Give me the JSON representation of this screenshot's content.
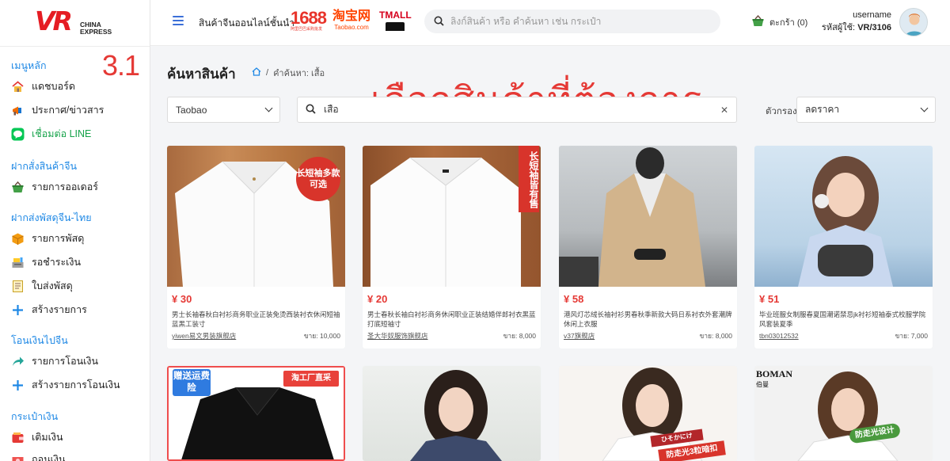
{
  "brand": {
    "logo_letters": "VR",
    "logo_line1": "CHINA",
    "logo_line2": "EXPRESS"
  },
  "step_label": "3.1",
  "sidebar": {
    "sections": [
      {
        "title": "เมนูหลัก",
        "items": [
          "แดชบอร์ด",
          "ประกาศ/ข่าวสาร",
          "เชื่อมต่อ LINE"
        ]
      },
      {
        "title": "ฝากสั่งสินค้าจีน",
        "items": [
          "รายการออเดอร์"
        ]
      },
      {
        "title": "ฝากส่งพัสดุจีน-ไทย",
        "items": [
          "รายการพัสดุ",
          "รอชำระเงิน",
          "ใบส่งพัสดุ",
          "สร้างรายการ"
        ]
      },
      {
        "title": "โอนเงินไปจีน",
        "items": [
          "รายการโอนเงิน",
          "สร้างรายการโอนเงิน"
        ]
      },
      {
        "title": "กระเป๋าเงิน",
        "items": [
          "เติมเงิน",
          "ถอนเงิน"
        ]
      }
    ]
  },
  "header": {
    "menu_icon": "hamburger-icon",
    "title": "สินค้าจีนออนไลน์ชั้นนำ",
    "brand_1688": "1688",
    "brand_1688_sub": "阿里巴巴采购批发",
    "brand_taobao": "淘宝网",
    "brand_taobao_sub": "Taobao.com",
    "brand_tmall": "TMALL",
    "search_placeholder": "ลิงก์สินค้า หรือ คำค้นหา เช่น กระเป๋า",
    "cart_label": "ตะกร้า (0)",
    "username": "username",
    "user_code_label": "รหัสผู้ใช้:",
    "user_code": "VR/3106"
  },
  "main": {
    "page_title": "ค้นหาสินค้า",
    "breadcrumb_current": "คำค้นหา: เสื้อ",
    "headline": "เลือกสินค้าที่ต้องการ",
    "source": "Taobao",
    "keyword": "เสื้อ",
    "filter_label": "ตัวกรอง",
    "sort": "ลดราคา"
  },
  "products": [
    {
      "price": "¥ 30",
      "name": "男士长袖春秋白衬衫商务职业正装免烫西装衬衣休闲短袖蓝黑工装寸",
      "shop": "yiwen易文男装旗舰店",
      "sold": "ขาย: 10,000",
      "tag": "长短袖多款可选"
    },
    {
      "price": "¥ 20",
      "name": "男士春秋长袖白衬衫商务休闲职业正装结婚伴郎衬衣黑蓝打底短袖寸",
      "shop": "圣大华奴服饰旗舰店",
      "sold": "ขาย: 8,000",
      "tag": "长短袖皆有售"
    },
    {
      "price": "¥ 58",
      "name": "港风灯芯绒长袖衬衫男春秋季新款大码日系衬衣外套潮牌休闲上衣服",
      "shop": "v37旗舰店",
      "sold": "ขาย: 8,000",
      "tag": ""
    },
    {
      "price": "¥ 51",
      "name": "毕业班服女制服春夏国潮诺禁忌jk衬衫短袖泰式校服学院风套装夏季",
      "shop": "tbn03012532",
      "sold": "ขาย: 7,000",
      "tag": ""
    },
    {
      "price": "",
      "name": "",
      "shop": "",
      "sold": "",
      "tag": "赠送运费险",
      "tag2": "淘工厂直采"
    },
    {
      "price": "",
      "name": "",
      "shop": "",
      "sold": "",
      "tag": ""
    },
    {
      "price": "",
      "name": "",
      "shop": "",
      "sold": "",
      "tag": "防走光3粒暗扣",
      "tag_small": "ひそかにけ"
    },
    {
      "price": "",
      "name": "",
      "shop": "",
      "sold": "",
      "tag": "防走光设计",
      "brand": "BOMAN",
      "brand_sub": "伯曼"
    }
  ],
  "colors": {
    "accent_red": "#e53935",
    "link_blue": "#1e88e5",
    "line_green": "#16a34a"
  }
}
